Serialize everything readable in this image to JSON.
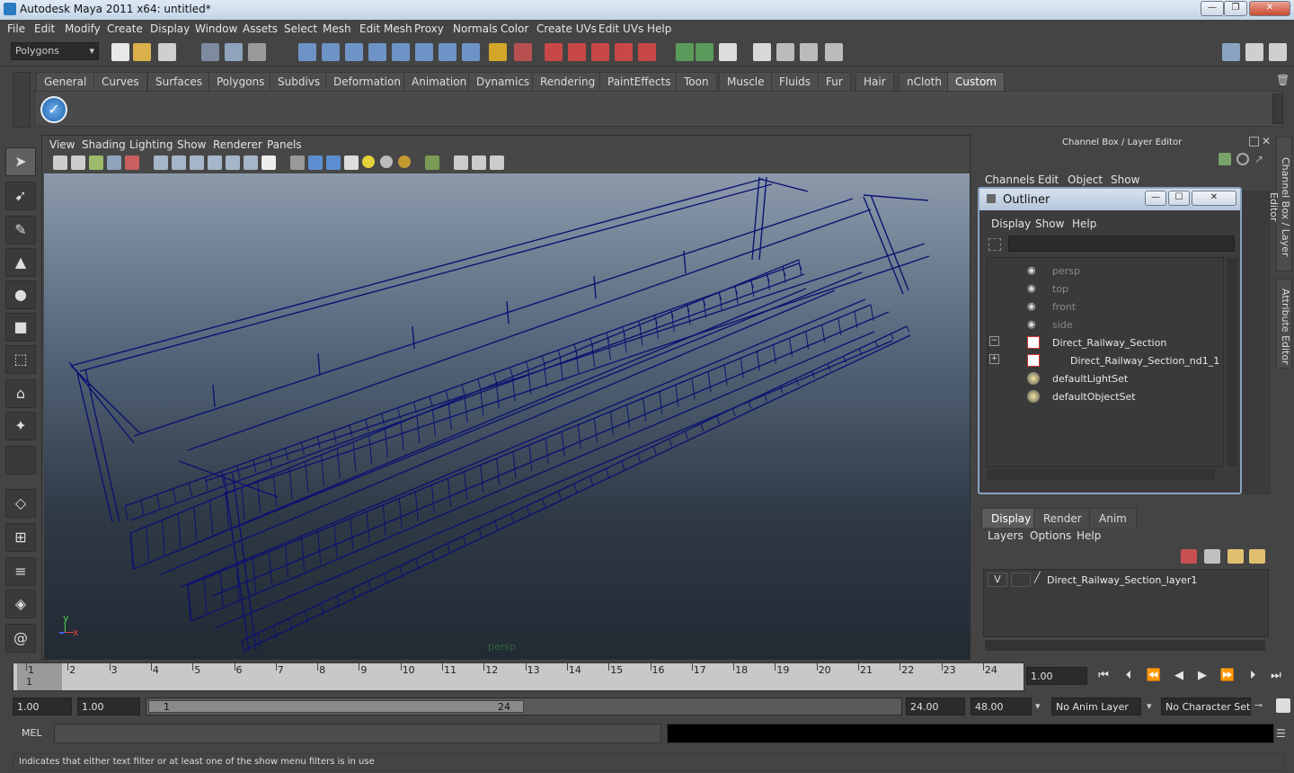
{
  "window": {
    "title": "Autodesk Maya 2011 x64: untitled*"
  },
  "menubar": [
    "File",
    "Edit",
    "Modify",
    "Create",
    "Display",
    "Window",
    "Assets",
    "Select",
    "Mesh",
    "Edit Mesh",
    "Proxy",
    "Normals",
    "Color",
    "Create UVs",
    "Edit UVs",
    "Help"
  ],
  "status": {
    "menuset": "Polygons"
  },
  "shelf_tabs": [
    "General",
    "Curves",
    "Surfaces",
    "Polygons",
    "Subdivs",
    "Deformation",
    "Animation",
    "Dynamics",
    "Rendering",
    "PaintEffects",
    "Toon",
    "Muscle",
    "Fluids",
    "Fur",
    "Hair",
    "nCloth",
    "Custom"
  ],
  "shelf_active": "Custom",
  "viewport": {
    "menus": [
      "View",
      "Shading",
      "Lighting",
      "Show",
      "Renderer",
      "Panels"
    ],
    "camera_label": "persp",
    "axis_x": "x",
    "axis_y": "y"
  },
  "channel_box": {
    "title": "Channel Box / Layer Editor",
    "menus": [
      "Channels",
      "Edit",
      "Object",
      "Show"
    ]
  },
  "outliner": {
    "title": "Outliner",
    "menus": [
      "Display",
      "Show",
      "Help"
    ],
    "items": [
      {
        "label": "persp",
        "dim": true
      },
      {
        "label": "top",
        "dim": true
      },
      {
        "label": "front",
        "dim": true
      },
      {
        "label": "side",
        "dim": true
      },
      {
        "label": "Direct_Railway_Section",
        "dim": false,
        "expand": "−"
      },
      {
        "label": "Direct_Railway_Section_nd1_1",
        "dim": false,
        "expand": "+"
      },
      {
        "label": "defaultLightSet",
        "dim": false
      },
      {
        "label": "defaultObjectSet",
        "dim": false
      }
    ]
  },
  "layer_editor": {
    "tabs": [
      "Display",
      "Render",
      "Anim"
    ],
    "active_tab": "Display",
    "menus": [
      "Layers",
      "Options",
      "Help"
    ],
    "layer": {
      "visible": "V",
      "name": "Direct_Railway_Section_layer1"
    }
  },
  "side_tabs": [
    "Channel Box / Layer Editor",
    "Attribute Editor"
  ],
  "timeline": {
    "ticks": [
      "1",
      "2",
      "3",
      "4",
      "5",
      "6",
      "7",
      "8",
      "9",
      "10",
      "11",
      "12",
      "13",
      "14",
      "15",
      "16",
      "17",
      "18",
      "19",
      "20",
      "21",
      "22",
      "23",
      "24"
    ],
    "current_frame": "1",
    "current_time": "1.00"
  },
  "range": {
    "start": "1.00",
    "playback_start": "1.00",
    "slider_start": "1",
    "slider_end": "24",
    "playback_end": "24.00",
    "end": "48.00",
    "anim_layer": "No Anim Layer",
    "character_set": "No Character Set"
  },
  "command": {
    "label": "MEL"
  },
  "help_line": "Indicates that either text filter or at least one of the show menu filters is in use",
  "colors": {
    "wireframe": "#0d1270",
    "accent": "#8aa3c0"
  }
}
